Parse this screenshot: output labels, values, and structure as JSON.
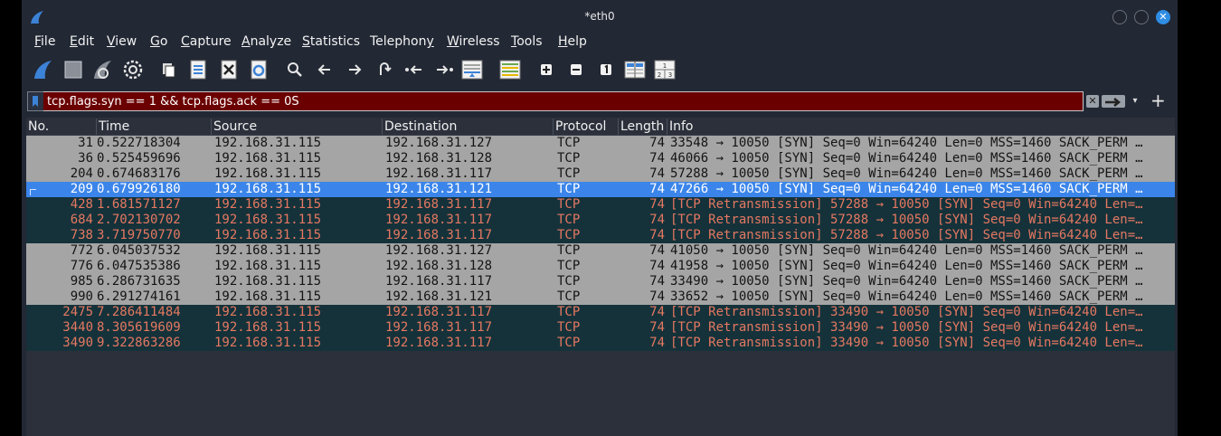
{
  "window": {
    "title": "*eth0",
    "close_glyph": "✕"
  },
  "menu": {
    "items": [
      {
        "label": "File",
        "ul": "F",
        "rest": "ile"
      },
      {
        "label": "Edit",
        "ul": "E",
        "rest": "dit"
      },
      {
        "label": "View",
        "ul": "V",
        "rest": "iew"
      },
      {
        "label": "Go",
        "ul": "G",
        "rest": "o"
      },
      {
        "label": "Capture",
        "ul": "C",
        "rest": "apture"
      },
      {
        "label": "Analyze",
        "ul": "A",
        "rest": "nalyze"
      },
      {
        "label": "Statistics",
        "ul": "S",
        "rest": "tatistics"
      },
      {
        "label": "Telephony",
        "ul": "y",
        "pre": "Telephon",
        "rest": ""
      },
      {
        "label": "Wireless",
        "ul": "W",
        "rest": "ireless"
      },
      {
        "label": "Tools",
        "ul": "T",
        "rest": "ools"
      },
      {
        "label": "Help",
        "ul": "H",
        "rest": "elp"
      }
    ]
  },
  "toolbar": {
    "icons": [
      "shark-fin-start-icon",
      "stop-square-icon",
      "restart-fin-icon",
      "gear-options-icon",
      "open-file-icon",
      "save-file-icon",
      "close-file-icon",
      "reload-file-icon",
      "search-icon",
      "back-arrow-icon",
      "forward-arrow-icon",
      "go-to-packet-icon",
      "first-packet-icon",
      "last-packet-icon",
      "autoscroll-icon",
      "colorize-icon",
      "zoom-in-icon",
      "zoom-out-icon",
      "normal-size-icon",
      "resize-columns-icon",
      "layout-icon"
    ]
  },
  "filter": {
    "value": "tcp.flags.syn == 1 && tcp.flags.ack == 0S",
    "clear_glyph": "✕",
    "dropdown_glyph": "▾",
    "add_glyph": "+"
  },
  "columns": [
    "No.",
    "Time",
    "Source",
    "Destination",
    "Protocol",
    "Length",
    "Info"
  ],
  "packets": [
    {
      "no": "31",
      "time": "0.522718304",
      "src": "192.168.31.115",
      "dst": "192.168.31.127",
      "proto": "TCP",
      "len": "74",
      "info": "33548 → 10050 [SYN] Seq=0 Win=64240 Len=0 MSS=1460 SACK_PERM …",
      "style": "norm"
    },
    {
      "no": "36",
      "time": "0.525459696",
      "src": "192.168.31.115",
      "dst": "192.168.31.128",
      "proto": "TCP",
      "len": "74",
      "info": "46066 → 10050 [SYN] Seq=0 Win=64240 Len=0 MSS=1460 SACK_PERM …",
      "style": "norm"
    },
    {
      "no": "204",
      "time": "0.674683176",
      "src": "192.168.31.115",
      "dst": "192.168.31.117",
      "proto": "TCP",
      "len": "74",
      "info": "57288 → 10050 [SYN] Seq=0 Win=64240 Len=0 MSS=1460 SACK_PERM …",
      "style": "norm"
    },
    {
      "no": "209",
      "time": "0.679926180",
      "src": "192.168.31.115",
      "dst": "192.168.31.121",
      "proto": "TCP",
      "len": "74",
      "info": "47266 → 10050 [SYN] Seq=0 Win=64240 Len=0 MSS=1460 SACK_PERM …",
      "style": "sel"
    },
    {
      "no": "428",
      "time": "1.681571127",
      "src": "192.168.31.115",
      "dst": "192.168.31.117",
      "proto": "TCP",
      "len": "74",
      "info": "[TCP Retransmission] 57288 → 10050 [SYN] Seq=0 Win=64240 Len=…",
      "style": "retx"
    },
    {
      "no": "684",
      "time": "2.702130702",
      "src": "192.168.31.115",
      "dst": "192.168.31.117",
      "proto": "TCP",
      "len": "74",
      "info": "[TCP Retransmission] 57288 → 10050 [SYN] Seq=0 Win=64240 Len=…",
      "style": "retx"
    },
    {
      "no": "738",
      "time": "3.719750770",
      "src": "192.168.31.115",
      "dst": "192.168.31.117",
      "proto": "TCP",
      "len": "74",
      "info": "[TCP Retransmission] 57288 → 10050 [SYN] Seq=0 Win=64240 Len=…",
      "style": "retx"
    },
    {
      "no": "772",
      "time": "6.045037532",
      "src": "192.168.31.115",
      "dst": "192.168.31.127",
      "proto": "TCP",
      "len": "74",
      "info": "41050 → 10050 [SYN] Seq=0 Win=64240 Len=0 MSS=1460 SACK_PERM …",
      "style": "norm"
    },
    {
      "no": "776",
      "time": "6.047535386",
      "src": "192.168.31.115",
      "dst": "192.168.31.128",
      "proto": "TCP",
      "len": "74",
      "info": "41958 → 10050 [SYN] Seq=0 Win=64240 Len=0 MSS=1460 SACK_PERM …",
      "style": "norm"
    },
    {
      "no": "985",
      "time": "6.286731635",
      "src": "192.168.31.115",
      "dst": "192.168.31.117",
      "proto": "TCP",
      "len": "74",
      "info": "33490 → 10050 [SYN] Seq=0 Win=64240 Len=0 MSS=1460 SACK_PERM …",
      "style": "norm"
    },
    {
      "no": "990",
      "time": "6.291274161",
      "src": "192.168.31.115",
      "dst": "192.168.31.121",
      "proto": "TCP",
      "len": "74",
      "info": "33652 → 10050 [SYN] Seq=0 Win=64240 Len=0 MSS=1460 SACK_PERM …",
      "style": "norm"
    },
    {
      "no": "2475",
      "time": "7.286411484",
      "src": "192.168.31.115",
      "dst": "192.168.31.117",
      "proto": "TCP",
      "len": "74",
      "info": "[TCP Retransmission] 33490 → 10050 [SYN] Seq=0 Win=64240 Len=…",
      "style": "retx"
    },
    {
      "no": "3440",
      "time": "8.305619609",
      "src": "192.168.31.115",
      "dst": "192.168.31.117",
      "proto": "TCP",
      "len": "74",
      "info": "[TCP Retransmission] 33490 → 10050 [SYN] Seq=0 Win=64240 Len=…",
      "style": "retx"
    },
    {
      "no": "3490",
      "time": "9.322863286",
      "src": "192.168.31.115",
      "dst": "192.168.31.117",
      "proto": "TCP",
      "len": "74",
      "info": "[TCP Retransmission] 33490 → 10050 [SYN] Seq=0 Win=64240 Len=…",
      "style": "retx"
    }
  ],
  "colors": {
    "normal_row_bg": "#a5a5a5",
    "retransmission_row_bg": "#15323a",
    "retransmission_row_fg": "#e57861",
    "selected_row_bg": "#3b85ea",
    "filter_invalid_bg": "#6b0000"
  }
}
